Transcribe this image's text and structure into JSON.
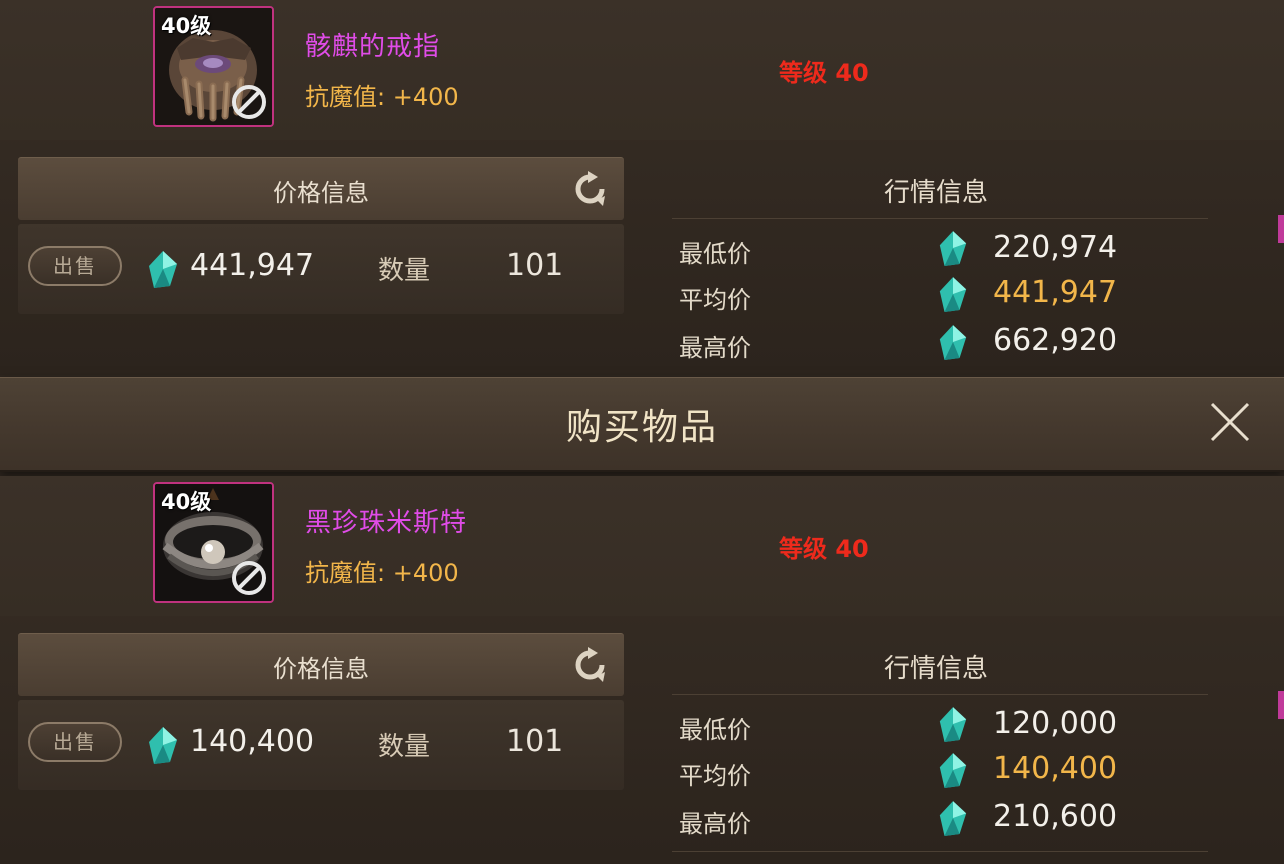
{
  "dialog": {
    "title": "购买物品"
  },
  "listings": [
    {
      "item": {
        "level_badge": "40级",
        "name": "骸麒的戒指",
        "stat": "抗魔值: +400",
        "level_requirement": "等级 40",
        "name_color": "#e04ce8",
        "frame_color": "#c0327f",
        "icon": "bone-ring-icon"
      },
      "price_info": {
        "title": "价格信息",
        "sell_label": "出售",
        "price": "441,947",
        "quantity_label": "数量",
        "quantity": "101"
      },
      "market_info": {
        "title": "行情信息",
        "rows": [
          {
            "label": "最低价",
            "value": "220,974"
          },
          {
            "label": "平均价",
            "value": "441,947"
          },
          {
            "label": "最高价",
            "value": "662,920"
          }
        ]
      }
    },
    {
      "item": {
        "level_badge": "40级",
        "name": "黑珍珠米斯特",
        "stat": "抗魔值: +400",
        "level_requirement": "等级 40",
        "name_color": "#e04ce8",
        "frame_color": "#c0327f",
        "icon": "black-pearl-ring-icon"
      },
      "price_info": {
        "title": "价格信息",
        "sell_label": "出售",
        "price": "140,400",
        "quantity_label": "数量",
        "quantity": "101"
      },
      "market_info": {
        "title": "行情信息",
        "rows": [
          {
            "label": "最低价",
            "value": "120,000"
          },
          {
            "label": "平均价",
            "value": "140,400"
          },
          {
            "label": "最高价",
            "value": "210,600"
          }
        ]
      }
    }
  ],
  "colors": {
    "background": "#2e261f",
    "accent_gold": "#f2b64a",
    "level_red": "#ee2a1c",
    "currency_gem": "#3fd7c4"
  }
}
